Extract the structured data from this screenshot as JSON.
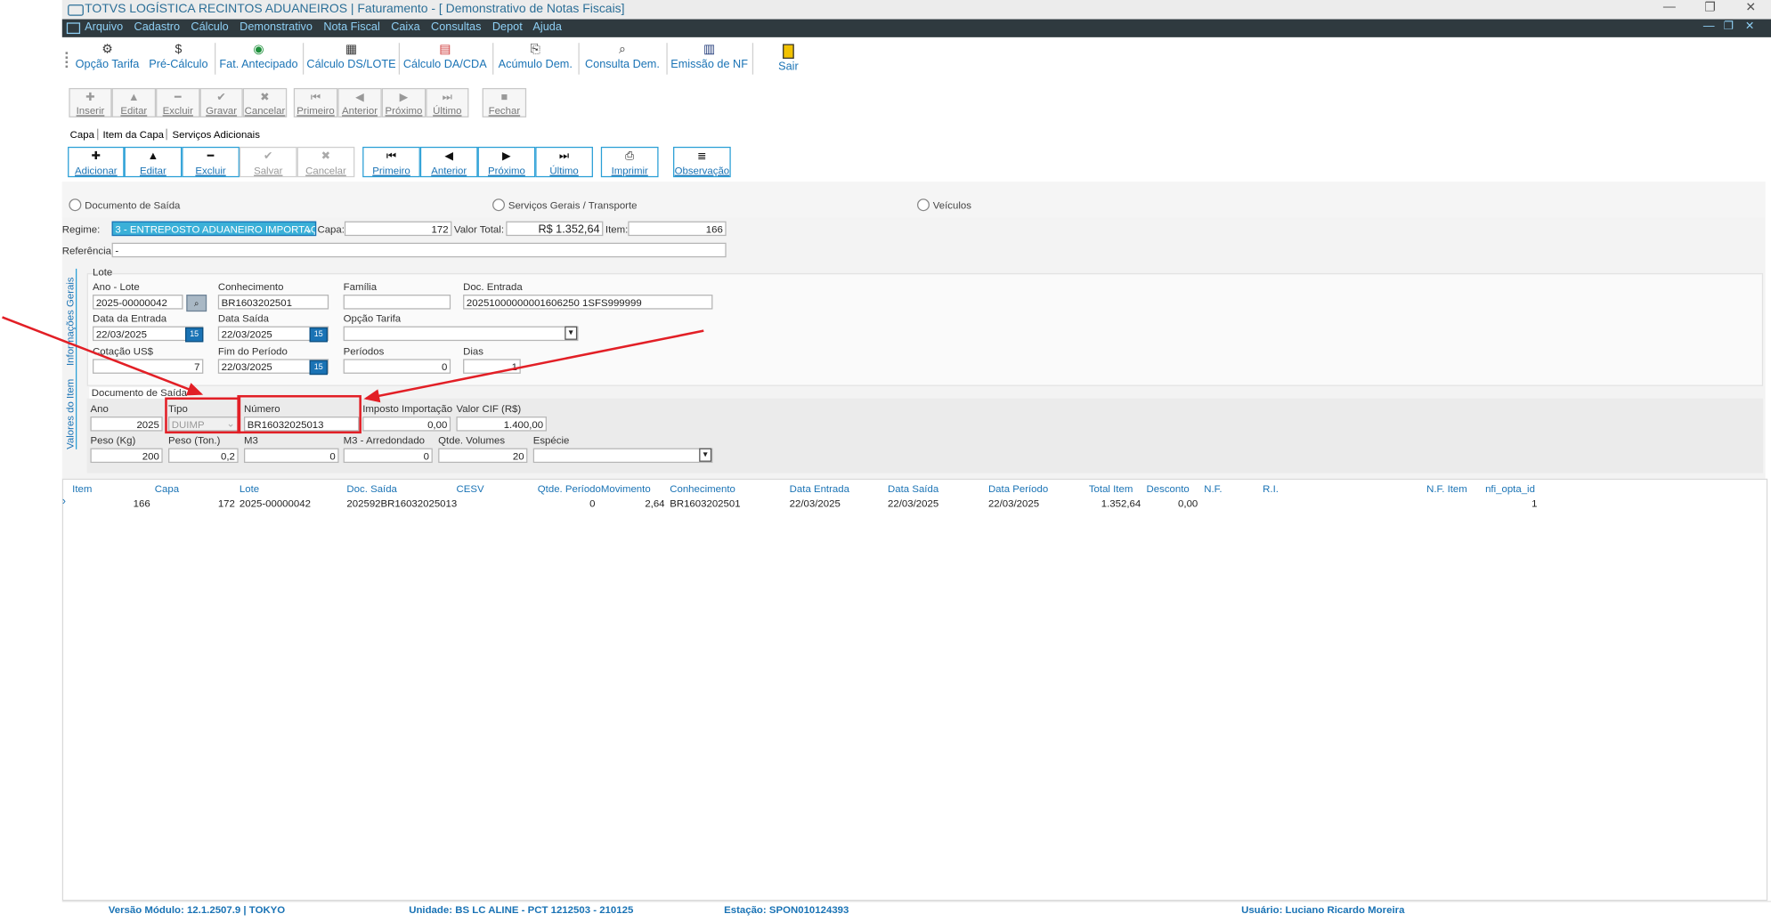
{
  "window": {
    "title": "TOTVS LOGÍSTICA RECINTOS ADUANEIROS | Faturamento - [ Demonstrativo de Notas Fiscais]",
    "minimize": "—",
    "restore": "❐",
    "close": "✕"
  },
  "menu": [
    "Arquivo",
    "Cadastro",
    "Cálculo",
    "Demonstrativo",
    "Nota Fiscal",
    "Caixa",
    "Consultas",
    "Depot",
    "Ajuda"
  ],
  "main_toolbar": [
    "Opção Tarifa",
    "Pré-Cálculo",
    "Fat. Antecipado",
    "Cálculo DS/LOTE",
    "Cálculo DA/CDA",
    "Acúmulo Dem.",
    "Consulta Dem.",
    "Emissão de NF",
    "Sair"
  ],
  "record_toolbar": [
    "Inserir",
    "Editar",
    "Excluir",
    "Gravar",
    "Cancelar",
    "Primeiro",
    "Anterior",
    "Próximo",
    "Último",
    "Fechar"
  ],
  "tabs": [
    "Capa",
    "Item da Capa",
    "Serviços Adicionais"
  ],
  "item_toolbar": [
    "Adicionar",
    "Editar",
    "Excluir",
    "Salvar",
    "Cancelar",
    "Primeiro",
    "Anterior",
    "Próximo",
    "Último",
    "Imprimir",
    "Observação"
  ],
  "radios": {
    "doc_saida": "Documento de Saída",
    "servicos": "Serviços Gerais / Transporte",
    "veiculos": "Veículos"
  },
  "header_fields": {
    "regime_label": "Regime:",
    "regime_value": "3 - ENTREPOSTO ADUANEIRO IMPORTAÇÃ",
    "capa_label": "Capa:",
    "capa_value": "172",
    "valor_total_label": "Valor Total:",
    "valor_total_value": "R$ 1.352,64",
    "item_label": "Item:",
    "item_value": "166",
    "referencia_label": "Referência:",
    "referencia_value": "-"
  },
  "side_tabs": {
    "info_gerais": "Informações Gerais",
    "valores_item": "Valores do Item"
  },
  "lote": {
    "group_label": "Lote",
    "ano_lote_label": "Ano - Lote",
    "ano_lote_value": "2025-00000042",
    "conhecimento_label": "Conhecimento",
    "conhecimento_value": "BR1603202501",
    "familia_label": "Família",
    "familia_value": "",
    "doc_entrada_label": "Doc. Entrada",
    "doc_entrada_value": "20251000000001606250 1SFS999999",
    "data_entrada_label": "Data da Entrada",
    "data_entrada_value": "22/03/2025",
    "data_saida_label": "Data Saída",
    "data_saida_value": "22/03/2025",
    "opcao_tarifa_label": "Opção Tarifa",
    "opcao_tarifa_value": "",
    "cotacao_label": "Cotação US$",
    "cotacao_value": "7",
    "fim_periodo_label": "Fim do Período",
    "fim_periodo_value": "22/03/2025",
    "periodos_label": "Períodos",
    "periodos_value": "0",
    "dias_label": "Dias",
    "dias_value": "1",
    "cal_icon": "15"
  },
  "doc_saida": {
    "group_label": "Documento de Saída",
    "ano_label": "Ano",
    "ano_value": "2025",
    "tipo_label": "Tipo",
    "tipo_value": "DUIMP",
    "numero_label": "Número",
    "numero_value": "BR16032025013",
    "imposto_label": "Imposto Importação",
    "imposto_value": "0,00",
    "valor_cif_label": "Valor CIF (R$)",
    "valor_cif_value": "1.400,00",
    "peso_kg_label": "Peso (Kg)",
    "peso_kg_value": "200",
    "peso_ton_label": "Peso (Ton.)",
    "peso_ton_value": "0,2",
    "m3_label": "M3",
    "m3_value": "0",
    "m3_arred_label": "M3 - Arredondado",
    "m3_arred_value": "0",
    "qtde_volumes_label": "Qtde. Volumes",
    "qtde_volumes_value": "20",
    "especie_label": "Espécie",
    "especie_value": ""
  },
  "grid": {
    "columns": [
      "Item",
      "Capa",
      "Lote",
      "Doc. Saída",
      "CESV",
      "Qtde. Período",
      "Movimento",
      "Conhecimento",
      "Data Entrada",
      "Data Saída",
      "Data Período",
      "Total Item",
      "Desconto",
      "N.F.",
      "R.I.",
      "N.F. Item",
      "nfi_opta_id"
    ],
    "rows": [
      [
        "166",
        "172",
        "2025-00000042",
        "202592BR16032025013",
        "",
        "0",
        "2,64",
        "BR1603202501",
        "22/03/2025",
        "22/03/2025",
        "22/03/2025",
        "1.352,64",
        "0,00",
        "",
        "",
        "",
        "1"
      ]
    ]
  },
  "status_bar": {
    "versao": "Versão Módulo:  12.1.2507.9  |  TOKYO",
    "unidade": "Unidade: BS LC ALINE - PCT 1212503 - 210125",
    "estacao": "Estação: SPON010124393",
    "usuario": "Usuário: Luciano Ricardo Moreira"
  },
  "colors": {
    "accent": "#1a73b5",
    "menubar": "#2f3a3f",
    "highlight_box": "#e21f26",
    "regime_select": "#3ab0d8"
  }
}
